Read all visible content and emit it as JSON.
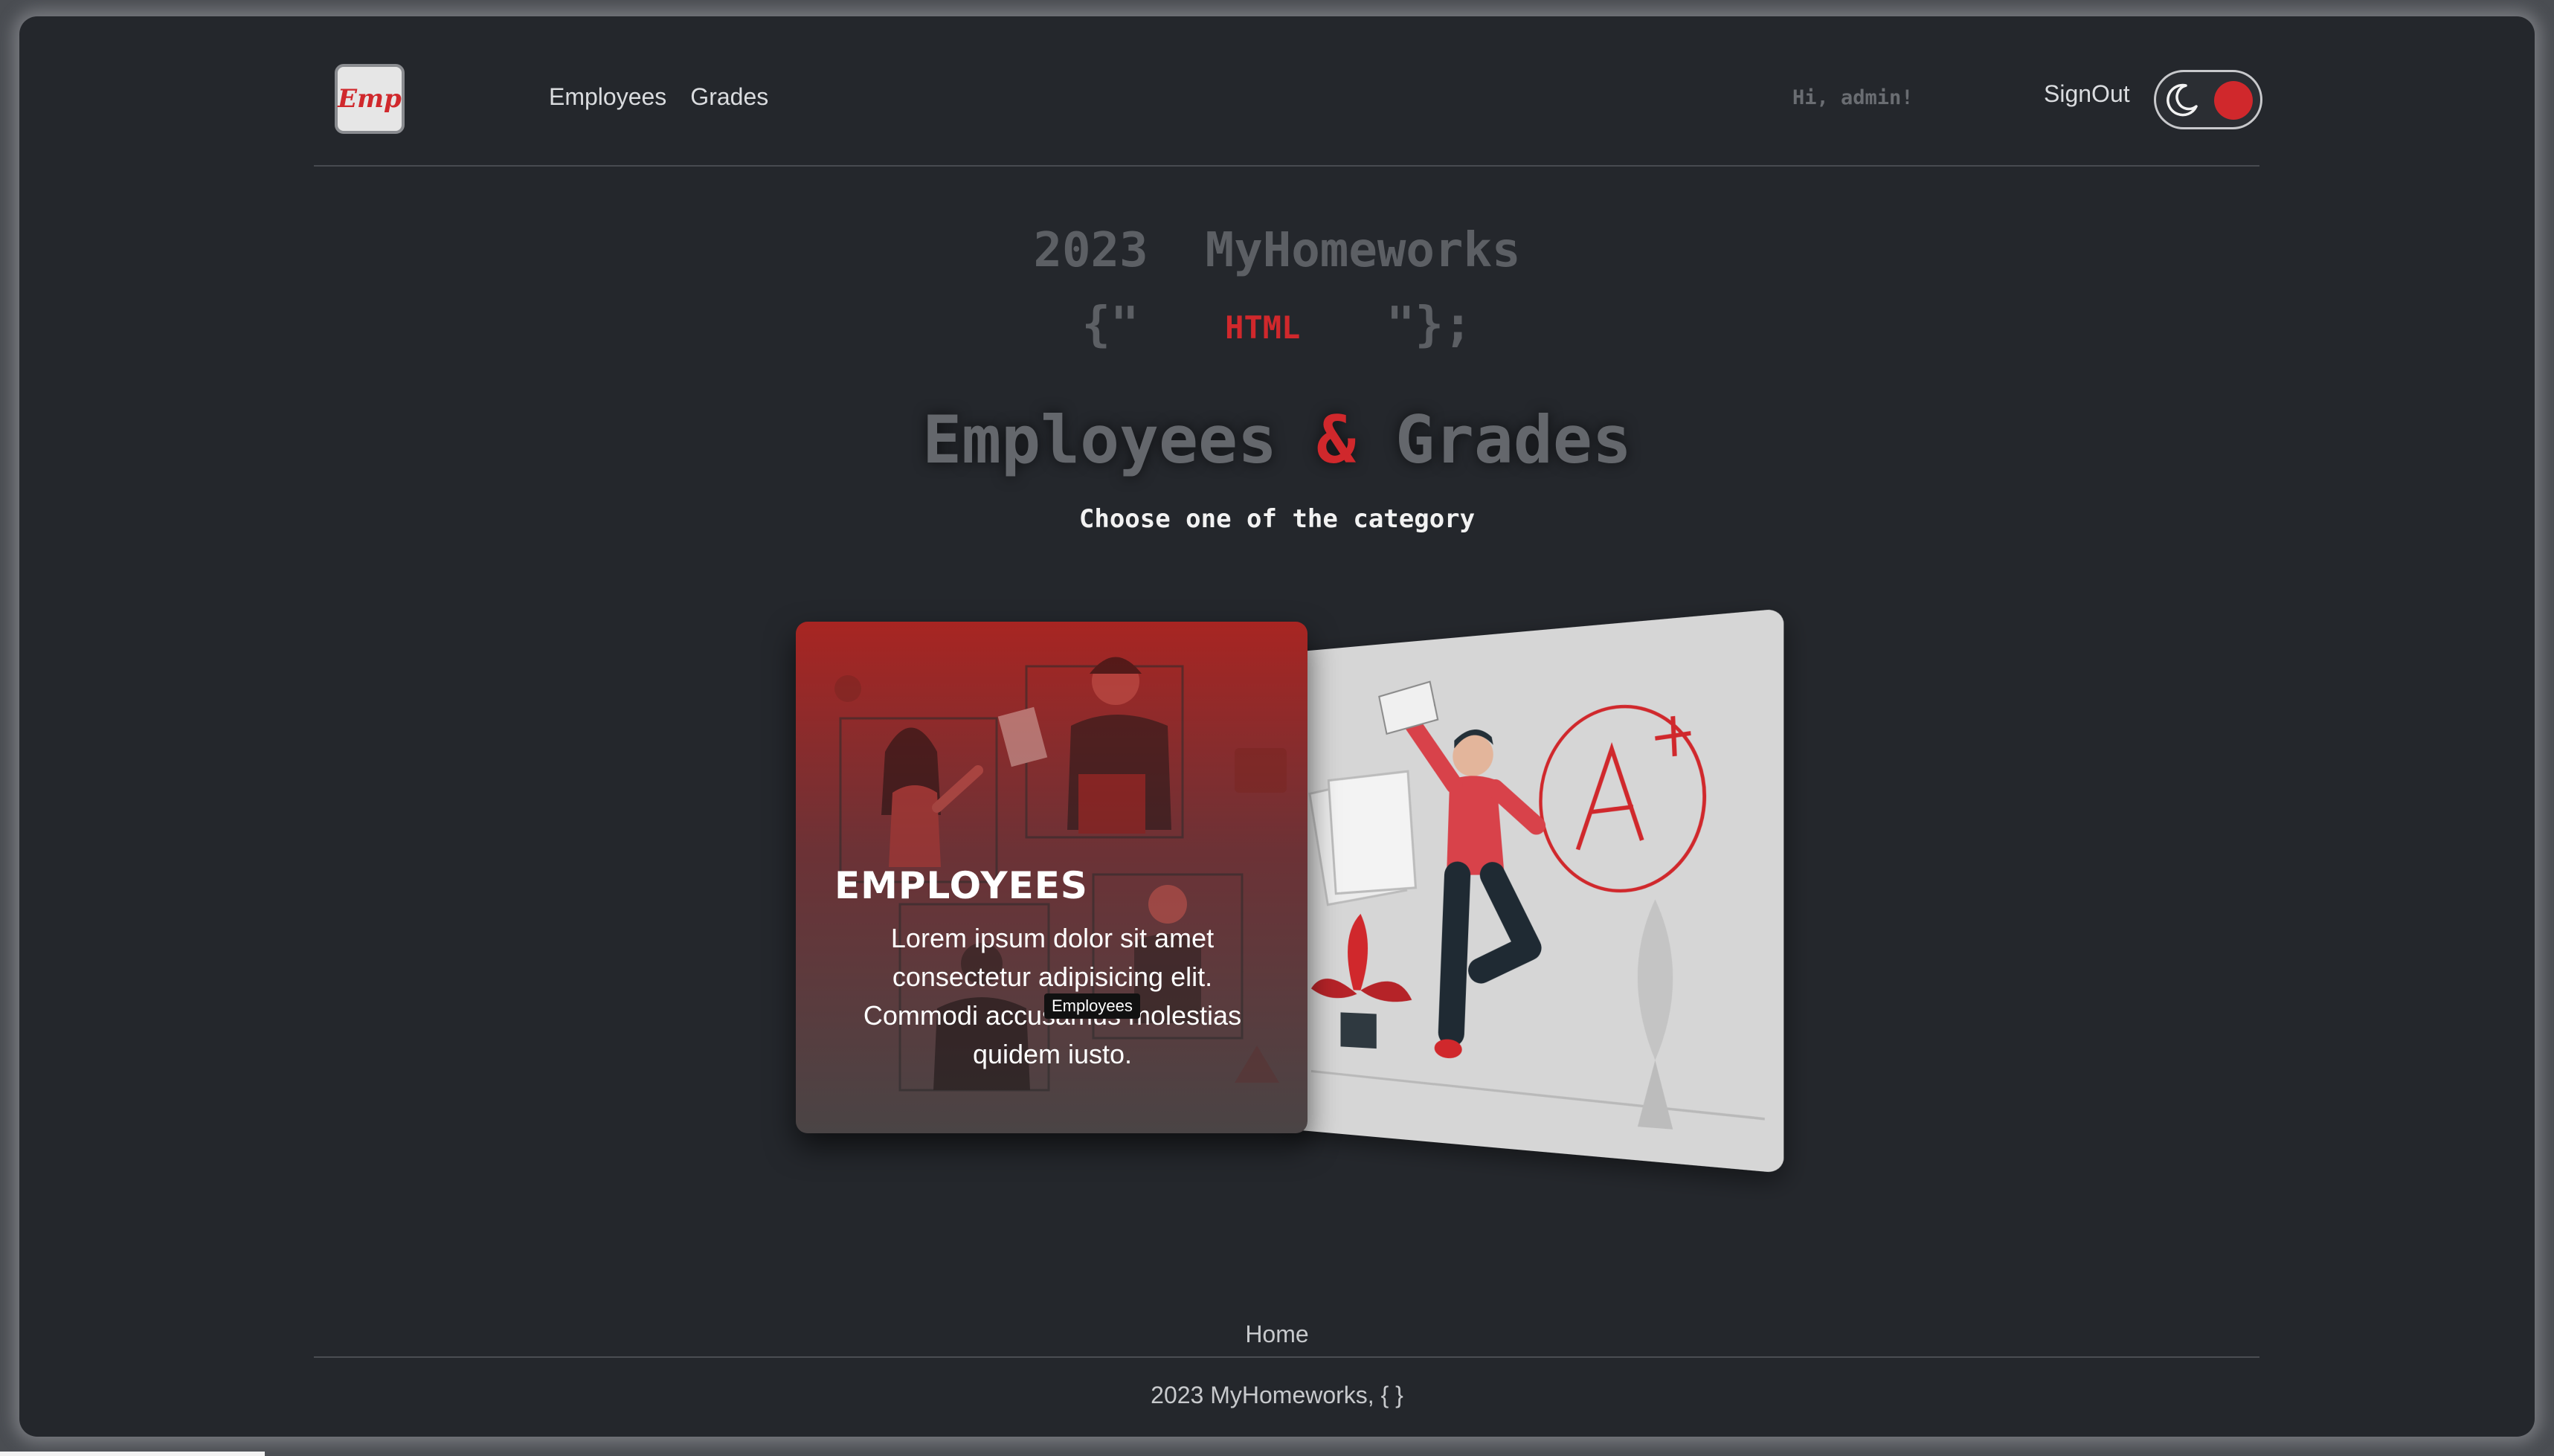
{
  "header": {
    "logo_text": "Emp",
    "nav": [
      {
        "label": "Employees"
      },
      {
        "label": "Grades"
      }
    ],
    "greeting": "Hi, admin!",
    "signout_label": "SignOut",
    "theme_toggle_icon": "moon-icon"
  },
  "hero": {
    "year": "2023",
    "brand": "MyHomeworks",
    "code_open": "{\"",
    "language": "HTML",
    "code_close": "\"};",
    "title_left": "Employees",
    "title_amp": "&",
    "title_right": "Grades",
    "subtitle": "Choose one of the category"
  },
  "cards": {
    "employees": {
      "title": "EMPLOYEES",
      "text": "Lorem ipsum dolor sit amet consectetur adipisicing elit. Commodi accusamus molestias quidem iusto.",
      "tooltip": "Employees"
    },
    "grades": {
      "illustration": "grade-a-plus-illustration"
    }
  },
  "footer": {
    "home_label": "Home",
    "copyright": "2023 MyHomeworks, { }"
  },
  "colors": {
    "accent": "#d0282c",
    "background": "#24272c"
  }
}
